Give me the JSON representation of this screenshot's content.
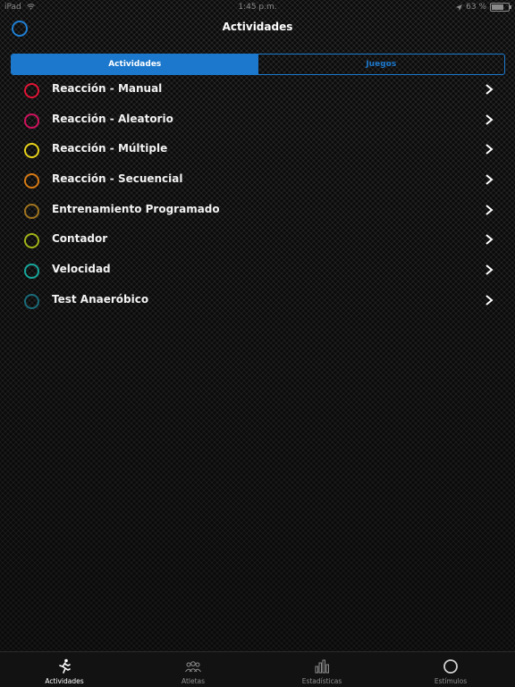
{
  "status_bar": {
    "device": "iPad",
    "time": "1:45 p.m.",
    "battery": "63 %",
    "battery_level": 0.63
  },
  "nav": {
    "title": "Actividades"
  },
  "segments": [
    {
      "label": "Actividades",
      "active": true
    },
    {
      "label": "Juegos",
      "active": false
    }
  ],
  "activities": [
    {
      "label": "Reacción - Manual",
      "color": "#e01436"
    },
    {
      "label": "Reacción - Aleatorio",
      "color": "#d0125e"
    },
    {
      "label": "Reacción - Múltiple",
      "color": "#e6d21a"
    },
    {
      "label": "Reacción - Secuencial",
      "color": "#d77a14"
    },
    {
      "label": "Entrenamiento Programado",
      "color": "#a0741e"
    },
    {
      "label": "Contador",
      "color": "#a2b418"
    },
    {
      "label": "Velocidad",
      "color": "#17a69a"
    },
    {
      "label": "Test Anaeróbico",
      "color": "#1a6b7a"
    }
  ],
  "tabs": [
    {
      "label": "Actividades",
      "icon": "runner-icon",
      "active": true
    },
    {
      "label": "Atletas",
      "icon": "group-icon",
      "active": false
    },
    {
      "label": "Estadísticas",
      "icon": "bar-chart-icon",
      "active": false
    },
    {
      "label": "Estímulos",
      "icon": "circle-icon",
      "active": false
    }
  ]
}
